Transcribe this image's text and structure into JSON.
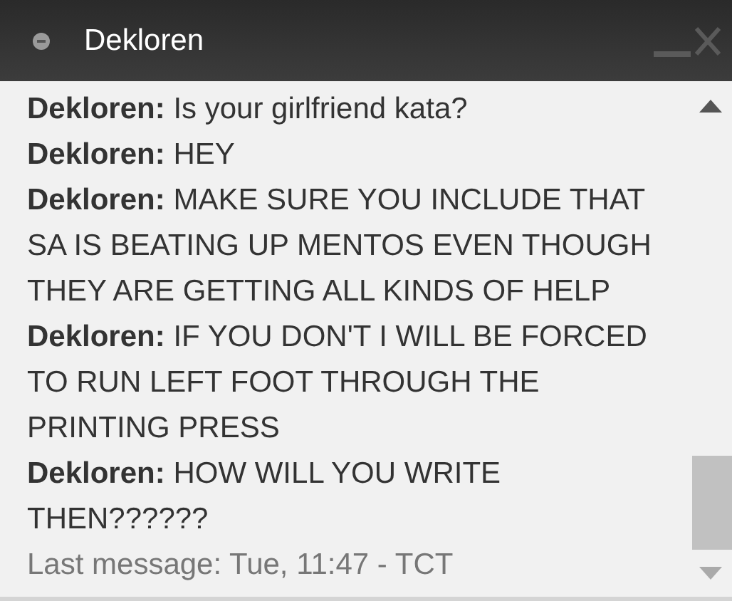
{
  "window": {
    "title": "Dekloren"
  },
  "messages": [
    {
      "sender": "Dekloren:",
      "text": "Is your girlfriend kata?"
    },
    {
      "sender": "Dekloren:",
      "text": "HEY"
    },
    {
      "sender": "Dekloren:",
      "text": "MAKE SURE YOU INCLUDE THAT SA IS BEATING UP MENTOS EVEN THOUGH THEY ARE GETTING ALL KINDS OF HELP"
    },
    {
      "sender": "Dekloren:",
      "text": "IF YOU DON'T I WILL BE FORCED TO RUN LEFT FOOT THROUGH THE PRINTING PRESS"
    },
    {
      "sender": "Dekloren:",
      "text": "HOW WILL YOU WRITE THEN??????"
    }
  ],
  "status": "Last message: Tue, 11:47 - TCT"
}
